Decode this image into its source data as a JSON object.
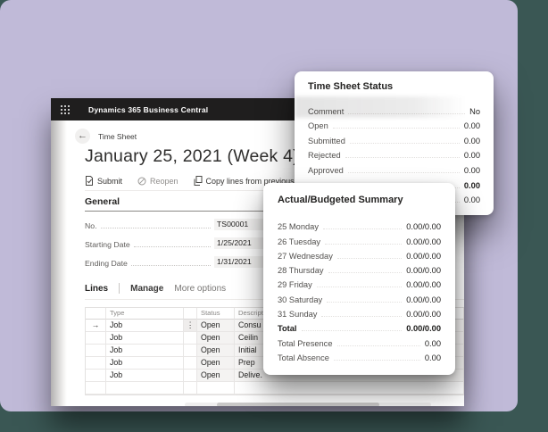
{
  "colors": {
    "page_background": "#3a5754",
    "card_background": "#c0bad8",
    "titlebar": "#1f1e1e",
    "field_box": "#f3f2f1",
    "text_primary": "#242322",
    "text_secondary": "#605e5c"
  },
  "icons": {
    "back": "←",
    "row_arrow": "→",
    "row_menu": "⋮"
  },
  "window": {
    "app_title": "Dynamics 365 Business Central",
    "page_caption": "Time Sheet",
    "page_title": "January 25, 2021 (Week 4)",
    "toolbar": {
      "submit": "Submit",
      "reopen": "Reopen",
      "copy_lines": "Copy lines from previous time sheet"
    },
    "general": {
      "heading": "General",
      "fields": [
        {
          "label": "No.",
          "value": "TS00001"
        },
        {
          "label": "Starting Date",
          "value": "1/25/2021"
        },
        {
          "label": "Ending Date",
          "value": "1/31/2021"
        }
      ]
    },
    "lines": {
      "tab_lines": "Lines",
      "tab_manage": "Manage",
      "tab_more": "More options",
      "columns": {
        "type": "Type",
        "status": "Status",
        "description": "Description"
      },
      "rows": [
        {
          "type": "Job",
          "status": "Open",
          "description": "Consu"
        },
        {
          "type": "Job",
          "status": "Open",
          "description": "Ceilin"
        },
        {
          "type": "Job",
          "status": "Open",
          "description": "Initial"
        },
        {
          "type": "Job",
          "status": "Open",
          "description": "Prep"
        },
        {
          "type": "Job",
          "status": "Open",
          "description": "Delive."
        }
      ]
    }
  },
  "status_panel": {
    "title": "Time Sheet Status",
    "rows": [
      {
        "label": "Comment",
        "value": "No"
      },
      {
        "label": "Open",
        "value": "0.00"
      },
      {
        "label": "Submitted",
        "value": "0.00"
      },
      {
        "label": "Rejected",
        "value": "0.00"
      },
      {
        "label": "Approved",
        "value": "0.00"
      },
      {
        "label": "",
        "value": "0.00"
      },
      {
        "label": "",
        "value": "0.00"
      }
    ]
  },
  "summary_panel": {
    "title": "Actual/Budgeted Summary",
    "rows": [
      {
        "label": "25 Monday",
        "value": "0.00/0.00"
      },
      {
        "label": "26 Tuesday",
        "value": "0.00/0.00"
      },
      {
        "label": "27 Wednesday",
        "value": "0.00/0.00"
      },
      {
        "label": "28 Thursday",
        "value": "0.00/0.00"
      },
      {
        "label": "29 Friday",
        "value": "0.00/0.00"
      },
      {
        "label": "30 Saturday",
        "value": "0.00/0.00"
      },
      {
        "label": "31 Sunday",
        "value": "0.00/0.00"
      },
      {
        "label": "Total",
        "value": "0.00/0.00"
      },
      {
        "label": "Total Presence",
        "value": "0.00"
      },
      {
        "label": "Total Absence",
        "value": "0.00"
      }
    ]
  }
}
